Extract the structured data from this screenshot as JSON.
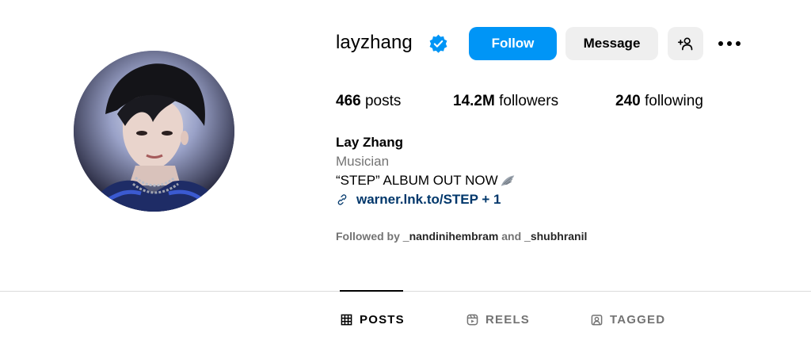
{
  "profile": {
    "username": "layzhang",
    "verified_icon": "verified-badge-icon",
    "full_name": "Lay Zhang",
    "category": "Musician",
    "bio": "“STEP” ALBUM OUT NOW",
    "link_text": "warner.lnk.to/STEP + 1",
    "followed_by_prefix": "Followed by",
    "followed_by_user1": "_nandinihembram",
    "followed_by_and": "and",
    "followed_by_user2": "_shubhranil"
  },
  "actions": {
    "follow_label": "Follow",
    "message_label": "Message",
    "add_user_icon": "add-user-icon",
    "more_icon": "more-options-icon"
  },
  "stats": {
    "posts_count": "466",
    "posts_label": "posts",
    "followers_count": "14.2M",
    "followers_label": "followers",
    "following_count": "240",
    "following_label": "following"
  },
  "tabs": [
    {
      "label": "POSTS",
      "icon": "grid-icon",
      "active": true
    },
    {
      "label": "REELS",
      "icon": "reels-icon",
      "active": false
    },
    {
      "label": "TAGGED",
      "icon": "tagged-icon",
      "active": false
    }
  ],
  "colors": {
    "accent": "#0095f6",
    "link": "#00376b",
    "secondary_text": "#737373",
    "button_bg": "#efefef"
  }
}
